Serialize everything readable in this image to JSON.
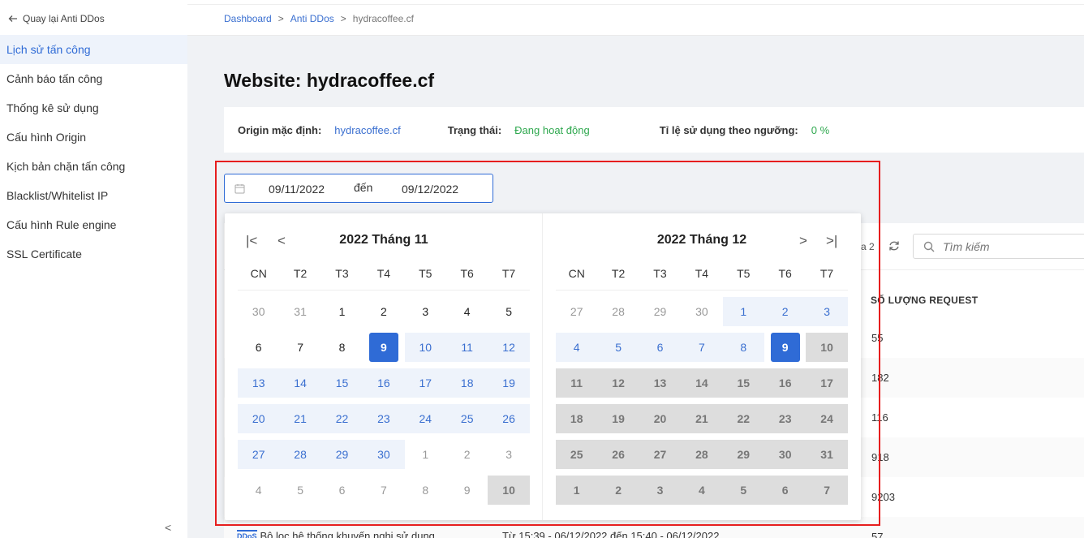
{
  "sidebar": {
    "back_label": "Quay lại Anti DDos",
    "items": [
      {
        "label": "Lịch sử tấn công",
        "active": true
      },
      {
        "label": "Cảnh báo tấn công"
      },
      {
        "label": "Thống kê sử dụng"
      },
      {
        "label": "Cấu hình Origin"
      },
      {
        "label": "Kịch bản chặn tấn công"
      },
      {
        "label": "Blacklist/Whitelist IP"
      },
      {
        "label": "Cấu hình Rule engine"
      },
      {
        "label": "SSL Certificate"
      }
    ],
    "collapse_label": "<"
  },
  "breadcrumb": {
    "items": [
      "Dashboard",
      "Anti DDos"
    ],
    "sep": ">",
    "current": "hydracoffee.cf"
  },
  "page": {
    "title": "Website: hydracoffee.cf"
  },
  "info": {
    "origin_label": "Origin mặc định:",
    "origin_value": "hydracoffee.cf",
    "status_label": "Trạng thái:",
    "status_value": "Đang hoạt động",
    "ratio_label": "Tỉ lệ sử dụng theo ngưỡng:",
    "ratio_value": "0 %"
  },
  "range": {
    "start": "09/11/2022",
    "to": "đến",
    "end": "09/12/2022"
  },
  "calendar": {
    "weekdays": [
      "CN",
      "T2",
      "T3",
      "T4",
      "T5",
      "T6",
      "T7"
    ],
    "left": {
      "title": "2022 Tháng 11",
      "nav_first": "|<",
      "nav_prev": "<",
      "days": [
        [
          "30",
          "31",
          "1",
          "2",
          "3",
          "4",
          "5"
        ],
        [
          "6",
          "7",
          "8",
          "9",
          "10",
          "11",
          "12"
        ],
        [
          "13",
          "14",
          "15",
          "16",
          "17",
          "18",
          "19"
        ],
        [
          "20",
          "21",
          "22",
          "23",
          "24",
          "25",
          "26"
        ],
        [
          "27",
          "28",
          "29",
          "30",
          "1",
          "2",
          "3"
        ],
        [
          "4",
          "5",
          "6",
          "7",
          "8",
          "9",
          "10"
        ]
      ]
    },
    "right": {
      "title": "2022 Tháng 12",
      "nav_next": ">",
      "nav_last": ">|",
      "days": [
        [
          "27",
          "28",
          "29",
          "30",
          "1",
          "2",
          "3"
        ],
        [
          "4",
          "5",
          "6",
          "7",
          "8",
          "9",
          "10"
        ],
        [
          "11",
          "12",
          "13",
          "14",
          "15",
          "16",
          "17"
        ],
        [
          "18",
          "19",
          "20",
          "21",
          "22",
          "23",
          "24"
        ],
        [
          "25",
          "26",
          "27",
          "28",
          "29",
          "30",
          "31"
        ],
        [
          "1",
          "2",
          "3",
          "4",
          "5",
          "6",
          "7"
        ]
      ]
    }
  },
  "table": {
    "pager_partial": "a 2",
    "search_placeholder": "Tìm kiếm",
    "column_header": "SỐ LƯỢNG REQUEST",
    "request_values": [
      "55",
      "182",
      "116",
      "918",
      "9203",
      "57"
    ],
    "bottom_row_icon": "DDoS",
    "bottom_row_name": "Bộ lọc hệ thống khuyến nghị sử dụng",
    "bottom_row_time": "Từ 15:39 - 06/12/2022 đến 15:40 - 06/12/2022"
  },
  "colors": {
    "accent": "#2f6bd6",
    "status_green": "#2fa84f",
    "highlight_red": "#e61e1e",
    "range_bg": "#eef3fb",
    "disabled_bg": "#dddddd"
  }
}
